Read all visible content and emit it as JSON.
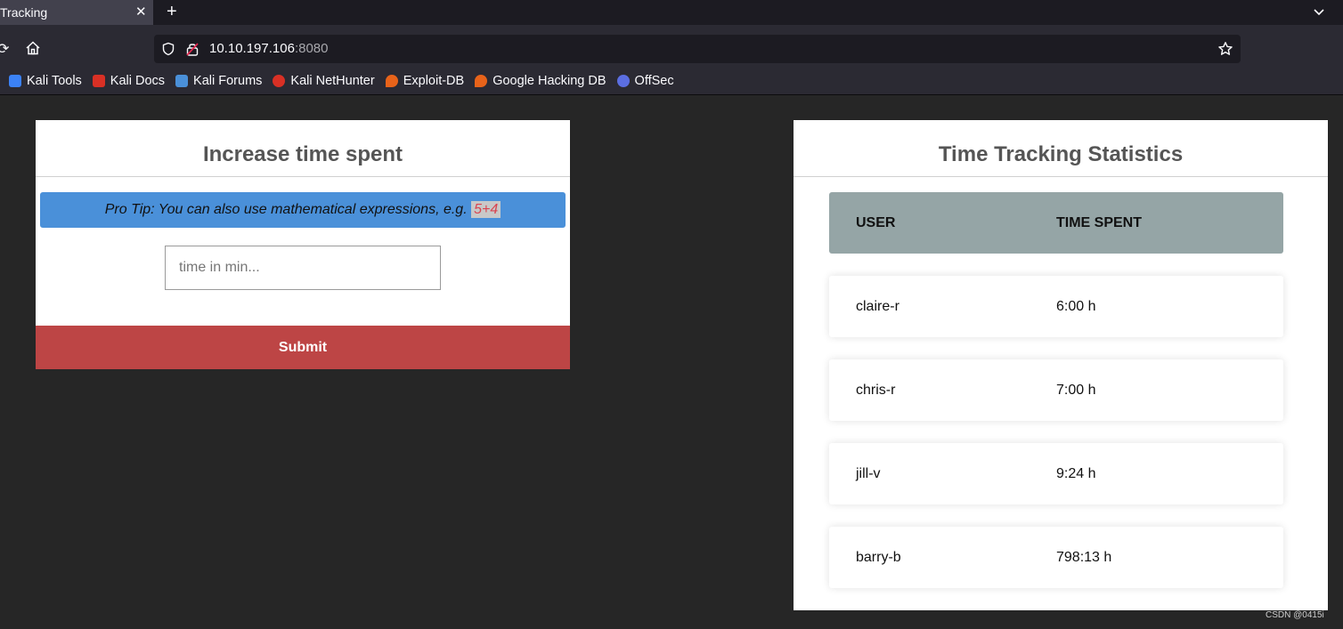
{
  "browser": {
    "tab_title": "Tracking",
    "new_tab_label": "+",
    "close_tab_label": "✕",
    "url_host": "10.10.197.106",
    "url_port": ":8080",
    "bookmarks": [
      {
        "label": "Kali Tools",
        "color": "#3b82f6"
      },
      {
        "label": "Kali Docs",
        "color": "#d93025"
      },
      {
        "label": "Kali Forums",
        "color": "#4a90d9"
      },
      {
        "label": "Kali NetHunter",
        "color": "#d93025"
      },
      {
        "label": "Exploit-DB",
        "color": "#e8631a"
      },
      {
        "label": "Google Hacking DB",
        "color": "#e8631a"
      },
      {
        "label": "OffSec",
        "color": "#5b6ee1"
      }
    ]
  },
  "increase_form": {
    "title": "Increase time spent",
    "tip_text": "Pro Tip: You can also use mathematical expressions, e.g. ",
    "tip_example": "5+4",
    "input_placeholder": "time in min...",
    "input_value": "",
    "submit_label": "Submit"
  },
  "stats": {
    "title": "Time Tracking Statistics",
    "columns": [
      "USER",
      "TIME SPENT"
    ],
    "rows": [
      {
        "user": "claire-r",
        "time": "6:00 h"
      },
      {
        "user": "chris-r",
        "time": "7:00 h"
      },
      {
        "user": "jill-v",
        "time": "9:24 h"
      },
      {
        "user": "barry-b",
        "time": "798:13 h"
      }
    ]
  },
  "watermark": "CSDN @0415i",
  "colors": {
    "page_bg": "#262626",
    "tip_bg": "#4a90d9",
    "submit_bg": "#bd4545",
    "table_head_bg": "#95a5a6"
  }
}
